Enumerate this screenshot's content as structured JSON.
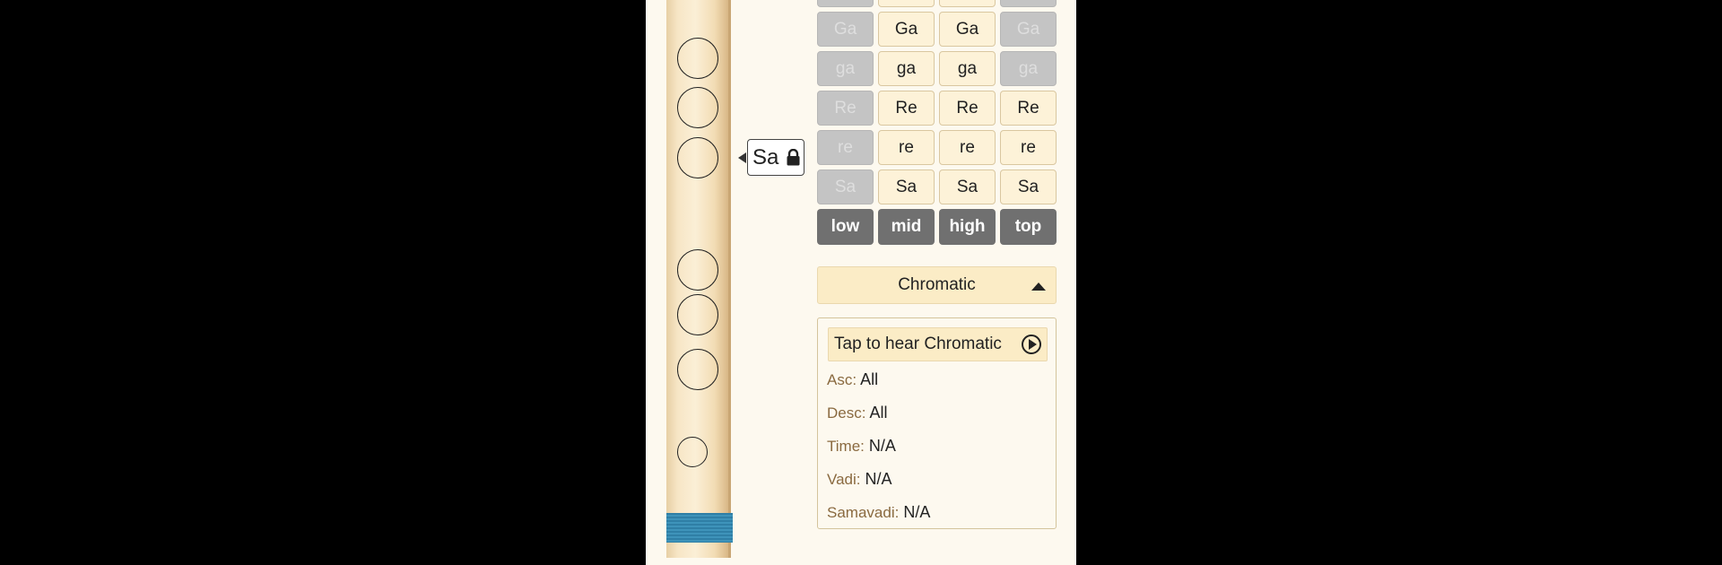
{
  "flute": {
    "selected_note": "Sa"
  },
  "note_rows": [
    {
      "label": "Ga",
      "enabled": [
        false,
        true,
        true,
        false
      ]
    },
    {
      "label": "ga",
      "enabled": [
        false,
        true,
        true,
        false
      ]
    },
    {
      "label": "Re",
      "enabled": [
        false,
        true,
        true,
        true
      ]
    },
    {
      "label": "re",
      "enabled": [
        false,
        true,
        true,
        true
      ]
    },
    {
      "label": "Sa",
      "enabled": [
        false,
        true,
        true,
        true
      ]
    }
  ],
  "octaves": [
    "low",
    "mid",
    "high",
    "top"
  ],
  "scale": {
    "selected": "Chromatic",
    "play_label": "Tap to hear Chromatic",
    "details": [
      {
        "key": "Asc:",
        "value": "All"
      },
      {
        "key": "Desc:",
        "value": "All"
      },
      {
        "key": "Time:",
        "value": "N/A"
      },
      {
        "key": "Vadi:",
        "value": "N/A"
      },
      {
        "key": "Samavadi:",
        "value": "N/A"
      }
    ]
  },
  "colors": {
    "accent": "#fbecc6",
    "disabled": "#c4c4c4",
    "octave_button": "#707070",
    "flute_band": "#2f7fa6"
  },
  "icons": {
    "lock": "lock-icon",
    "play": "play-icon",
    "caret": "caret-up-icon"
  }
}
